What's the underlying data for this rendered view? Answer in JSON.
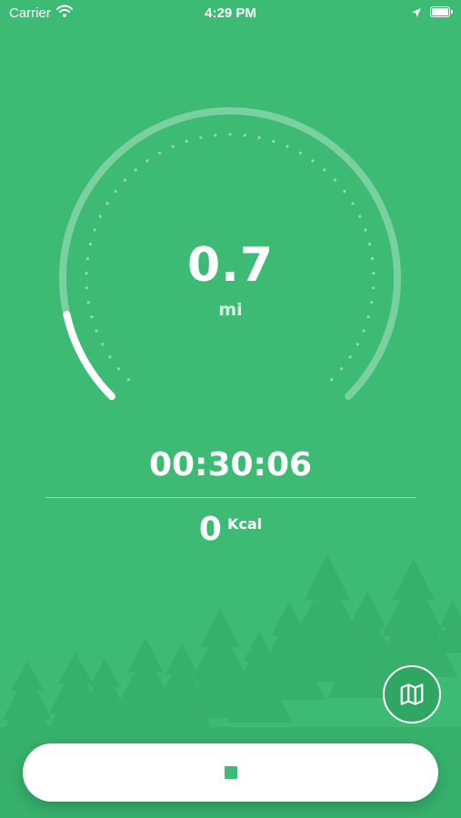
{
  "status_bar": {
    "carrier": "Carrier",
    "time": "4:29 PM",
    "icons": [
      "wifi-icon",
      "location-arrow-icon",
      "battery-icon"
    ]
  },
  "tracker": {
    "distance": "0.7",
    "distance_unit": "mi",
    "gauge_progress": 0.12,
    "elapsed_time": "00:30:06",
    "calories": "0",
    "calories_unit": "Kcal"
  },
  "controls": {
    "map_icon": "map-icon",
    "stop_icon": "stop-icon"
  },
  "colors": {
    "background": "#3dba73",
    "accent": "#ffffff",
    "tree": "#34ad68"
  }
}
